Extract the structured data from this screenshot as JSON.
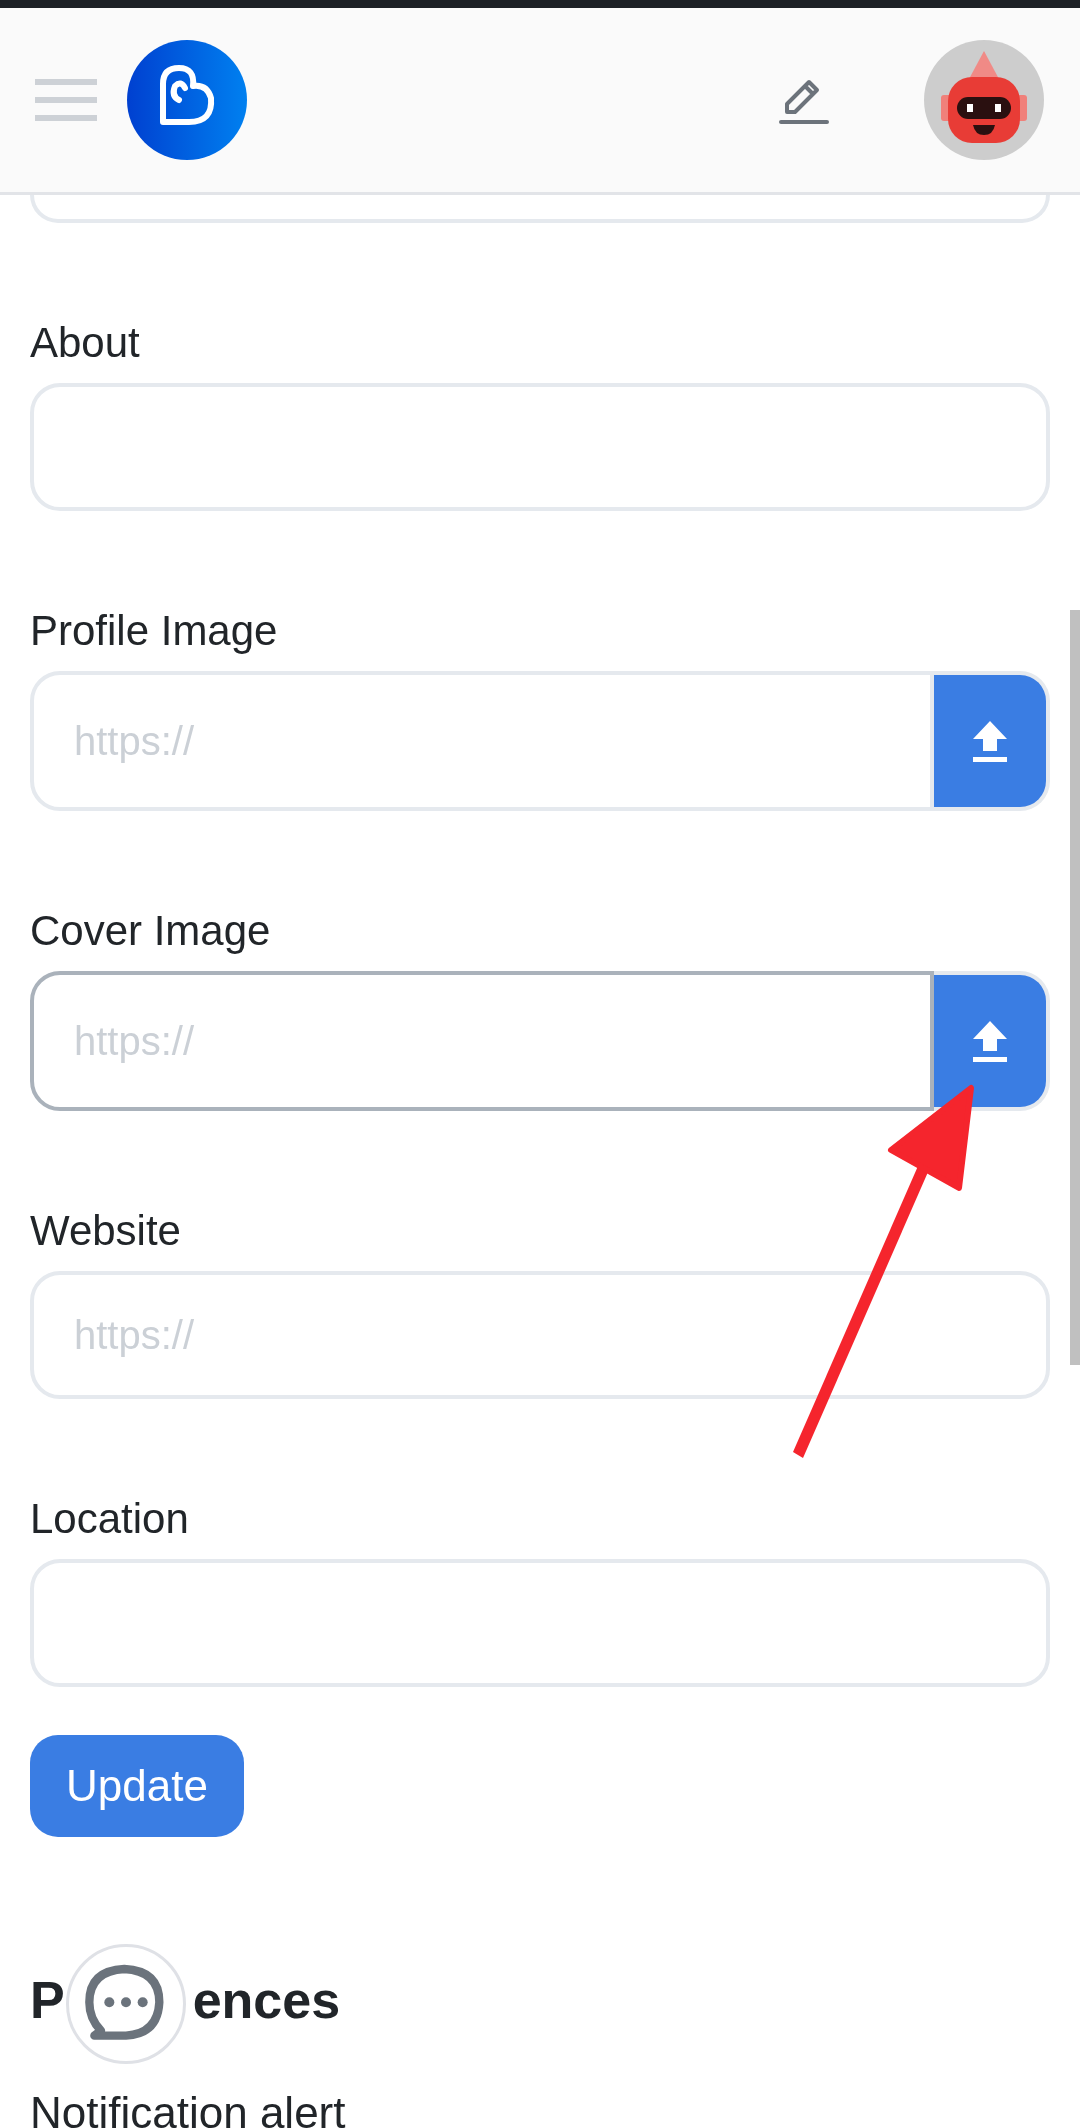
{
  "fields": [
    {
      "label": "About",
      "kind": "text",
      "focused": false
    },
    {
      "label": "Profile Image",
      "kind": "upload",
      "placeholder": "https://",
      "focused": false
    },
    {
      "label": "Cover Image",
      "kind": "upload",
      "placeholder": "https://",
      "focused": true
    },
    {
      "label": "Website",
      "kind": "text",
      "placeholder": "https://",
      "focused": false
    },
    {
      "label": "Location",
      "kind": "text",
      "focused": false
    }
  ],
  "update_button": "Update",
  "section_heading": [
    "P",
    "ences"
  ],
  "next_label": "Notification alert"
}
